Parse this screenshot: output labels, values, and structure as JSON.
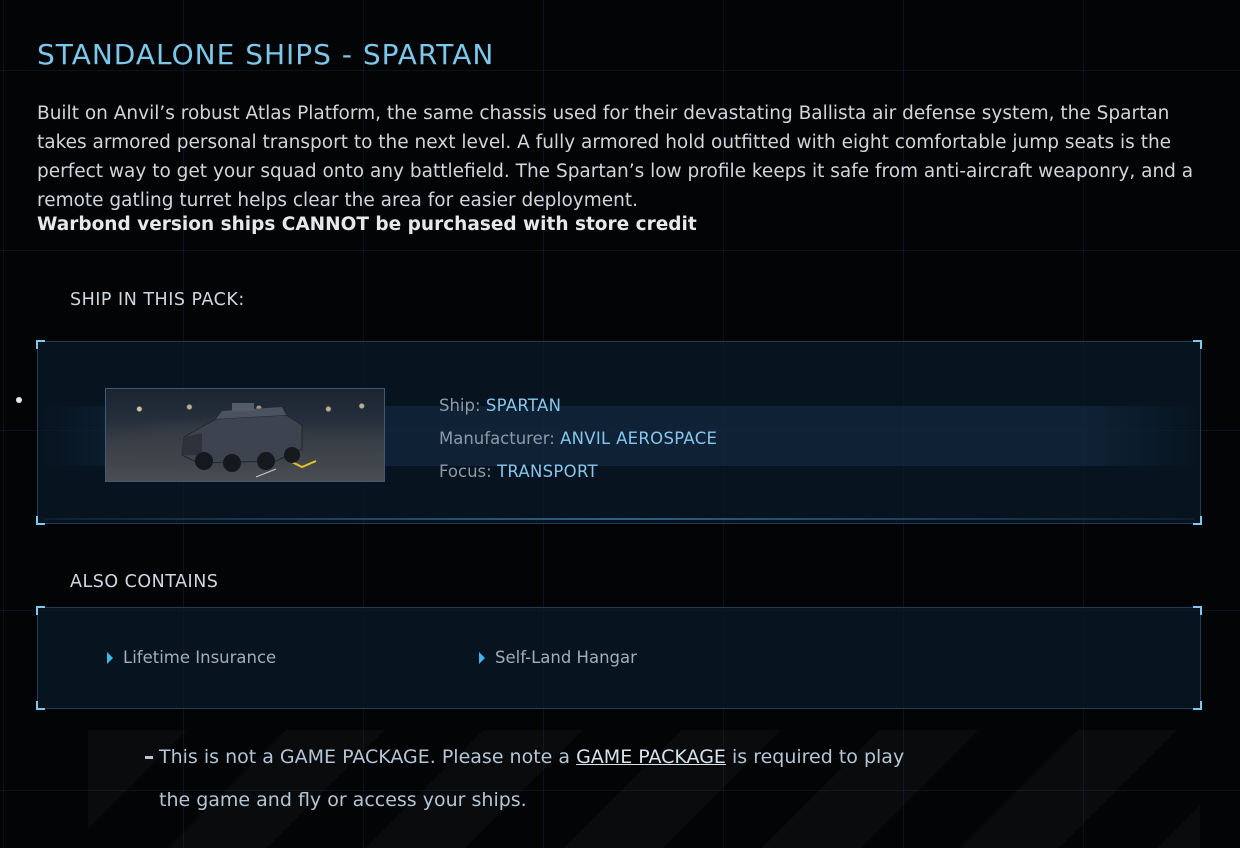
{
  "page": {
    "title": "STANDALONE SHIPS - SPARTAN",
    "description": "Built on Anvil’s robust Atlas Platform, the same chassis used for their devastating Ballista air defense system, the Spartan takes armored personal transport to the next level. A fully armored hold outfitted with eight comfortable jump seats is the perfect way to get your squad onto any battlefield. The Spartan’s low profile keeps it safe from anti-aircraft weaponry, and a remote gatling turret helps clear the area for easier deployment.",
    "warning": "Warbond version ships CANNOT be purchased with store credit"
  },
  "ship_section": {
    "label": "SHIP IN THIS PACK:",
    "ship": {
      "name_key": "Ship:",
      "name": "SPARTAN",
      "manufacturer_key": "Manufacturer:",
      "manufacturer": "ANVIL AEROSPACE",
      "focus_key": "Focus:",
      "focus": "TRANSPORT"
    }
  },
  "also_contains": {
    "label": "ALSO CONTAINS",
    "items": [
      "Lifetime Insurance",
      "Self-Land Hangar"
    ]
  },
  "notice": {
    "text_before": "This is not a GAME PACKAGE. Please note a ",
    "link": "GAME PACKAGE",
    "text_after": " is required to play",
    "line2": "the game and fly or access your ships."
  },
  "colors": {
    "accent": "#7cc7ea",
    "value": "#86c6ee",
    "arrow": "#3fb6ef",
    "background": "#020406"
  }
}
